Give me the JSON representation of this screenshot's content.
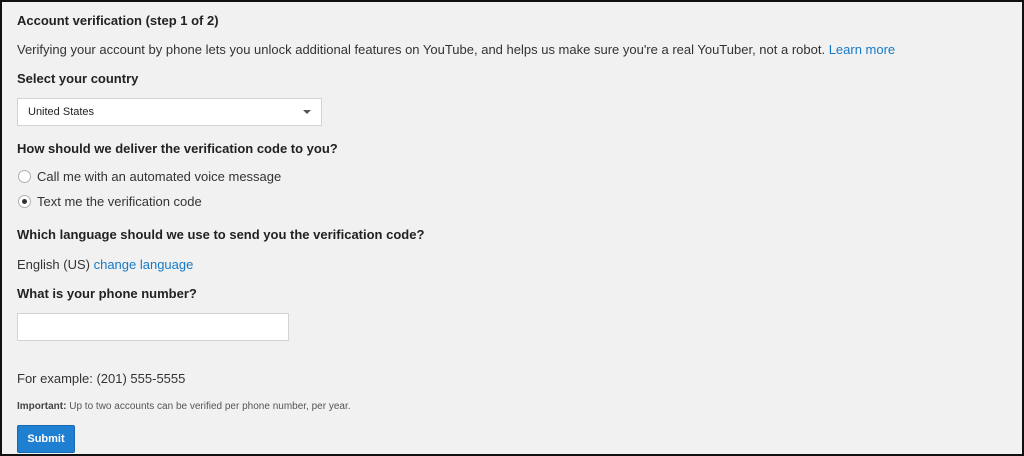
{
  "title": "Account verification (step 1 of 2)",
  "intro": {
    "text": "Verifying your account by phone lets you unlock additional features on YouTube, and helps us make sure you're a real YouTuber, not a robot.",
    "learn_more": "Learn more"
  },
  "country": {
    "label": "Select your country",
    "selected": "United States"
  },
  "delivery": {
    "label": "How should we deliver the verification code to you?",
    "options": [
      {
        "label": "Call me with an automated voice message",
        "checked": false
      },
      {
        "label": "Text me the verification code",
        "checked": true
      }
    ]
  },
  "language": {
    "label": "Which language should we use to send you the verification code?",
    "value": "English (US)",
    "change_link": "change language"
  },
  "phone": {
    "label": "What is your phone number?",
    "value": "",
    "example": "For example: (201) 555-5555"
  },
  "important": {
    "label": "Important:",
    "text": "Up to two accounts can be verified per phone number, per year."
  },
  "submit_label": "Submit",
  "colors": {
    "link": "#167ac6",
    "button": "#1f7fd1",
    "background": "#f1f1f1"
  }
}
